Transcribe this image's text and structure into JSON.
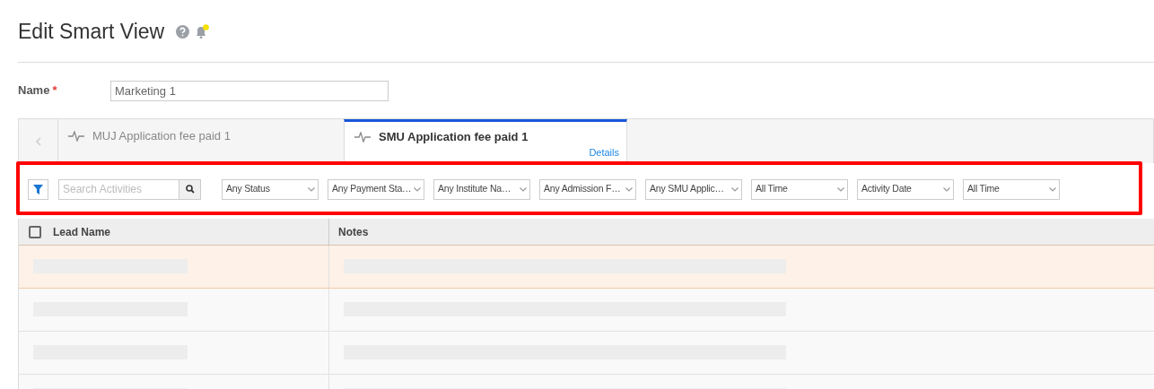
{
  "page_title": "Edit Smart View",
  "notification_dot": true,
  "name_field": {
    "label": "Name",
    "required_mark": "*",
    "value": "Marketing 1"
  },
  "tabs": [
    {
      "label": "MUJ Application fee paid 1",
      "selected": false
    },
    {
      "label": "SMU Application fee paid 1",
      "selected": true,
      "link": "Details"
    }
  ],
  "filters": {
    "search": {
      "placeholder": "Search Activities"
    },
    "dropdowns": [
      {
        "label": "Any Status"
      },
      {
        "label": "Any Payment Sta…"
      },
      {
        "label": "Any Institute Na…"
      },
      {
        "label": "Any Admission F…"
      },
      {
        "label": "Any SMU Applic…"
      },
      {
        "label": "All Time"
      },
      {
        "label": "Activity Date"
      },
      {
        "label": "All Time"
      }
    ]
  },
  "table": {
    "columns": [
      "Lead Name",
      "Notes"
    ],
    "select_all_checked": false,
    "rows": [
      {
        "highlighted": true
      },
      {
        "highlighted": false
      },
      {
        "highlighted": false
      },
      {
        "highlighted": false
      }
    ]
  }
}
